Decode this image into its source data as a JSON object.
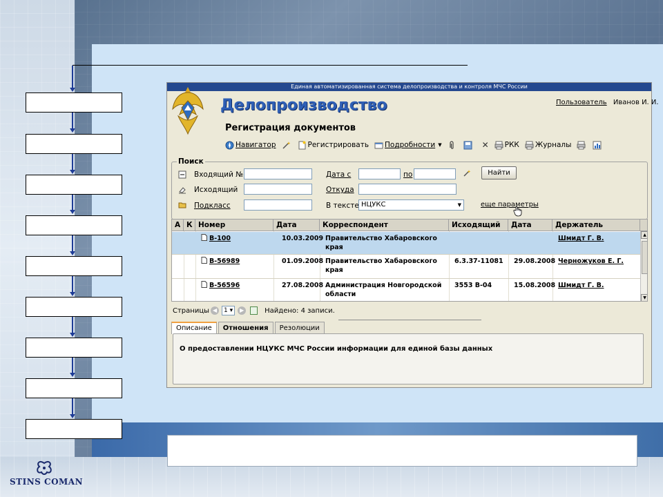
{
  "app": {
    "system_title": "Единая автоматизированная система делопроизводства и контроля МЧС России",
    "name": "Делопроизводство",
    "section_title": "Регистрация документов",
    "user": {
      "label": "Пользователь",
      "name": "Иванов И. И."
    }
  },
  "toolbar": {
    "navigator": "Навигатор",
    "register": "Регистрировать",
    "details": "Подробности",
    "rkk": "РКК",
    "journals": "Журналы"
  },
  "search": {
    "legend": "Поиск",
    "incoming_label": "Входящий №",
    "incoming_value": "",
    "outgoing_label": "Исходящий",
    "outgoing_value": "",
    "subclass_label": "Подкласс",
    "subclass_value": "",
    "date_from_label": "Дата с",
    "date_from_value": "",
    "date_to_label": "по",
    "date_to_value": "",
    "from_label": "Откуда",
    "from_value": "",
    "in_text_label": "В тексте",
    "in_text_value": "НЦУКС",
    "find_button": "Найти",
    "more_params": "еще параметры"
  },
  "table": {
    "columns": [
      "А",
      "К",
      "Номер",
      "Дата",
      "Корреспондент",
      "Исходящий",
      "Дата",
      "Держатель"
    ],
    "rows": [
      {
        "number": "В-100",
        "date": "10.03.2009",
        "correspondent": "Правительство Хабаровского края",
        "outgoing": "",
        "out_date": "",
        "holder": "Шмидт Г. В."
      },
      {
        "number": "В-56989",
        "date": "01.09.2008",
        "correspondent": "Правительство Хабаровского края",
        "outgoing": "6.3.37-11081",
        "out_date": "29.08.2008",
        "holder": "Черножуков Е. Г."
      },
      {
        "number": "В-56596",
        "date": "27.08.2008",
        "correspondent": "Администрация Новгородской области",
        "outgoing": "3553 В-04",
        "out_date": "15.08.2008",
        "holder": "Шмидт Г. В."
      }
    ]
  },
  "pager": {
    "label": "Страницы",
    "page": "1",
    "found": "Найдено: 4 записи."
  },
  "tabs": [
    "Описание",
    "Отношения",
    "Резолюции"
  ],
  "description": "О предоставлении НЦУКС МЧС России информации для единой базы данных",
  "logo": {
    "text": "STINS COMAN"
  },
  "colors": {
    "title_bar": "#24488f",
    "app_title": "#2f5fb5",
    "selected_row": "#bed8ee",
    "flow_arrow": "#1e3c96"
  }
}
